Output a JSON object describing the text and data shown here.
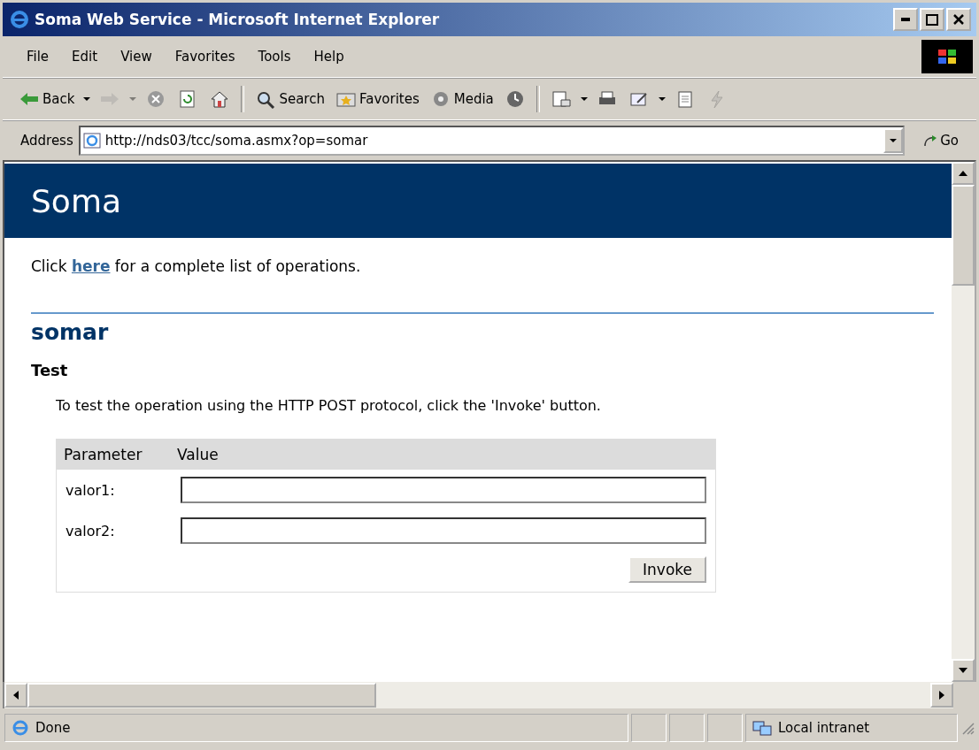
{
  "window": {
    "title": "Soma Web Service - Microsoft Internet Explorer"
  },
  "menu": [
    "File",
    "Edit",
    "View",
    "Favorites",
    "Tools",
    "Help"
  ],
  "toolbar": [
    {
      "kind": "back",
      "label": "Back",
      "disabled": false
    },
    {
      "kind": "forward",
      "disabled": true
    },
    {
      "kind": "stop",
      "disabled": false
    },
    {
      "kind": "refresh",
      "disabled": false
    },
    {
      "kind": "home",
      "disabled": false
    },
    {
      "kind": "search",
      "label": "Search",
      "disabled": false
    },
    {
      "kind": "favorites",
      "label": "Favorites",
      "disabled": false
    },
    {
      "kind": "media",
      "label": "Media",
      "disabled": false
    },
    {
      "kind": "history",
      "disabled": false
    },
    {
      "kind": "mail",
      "disabled": false
    },
    {
      "kind": "print",
      "disabled": false
    },
    {
      "kind": "edit",
      "disabled": false
    },
    {
      "kind": "discuss",
      "disabled": false
    },
    {
      "kind": "messenger",
      "disabled": true
    }
  ],
  "address": {
    "label": "Address",
    "value": "http://nds03/tcc/soma.asmx?op=somar",
    "go": "Go"
  },
  "page": {
    "banner": "Soma",
    "intro_before": "Click",
    "link": "here",
    "intro_after": "for a complete list of operations.",
    "operation": "somar",
    "section": "Test",
    "description": "To test the operation using the HTTP POST protocol, click the 'Invoke' button.",
    "table": {
      "columns": [
        "Parameter",
        "Value"
      ],
      "rows": [
        {
          "label": "valor1:"
        },
        {
          "label": "valor2:"
        }
      ]
    },
    "button": "Invoke"
  },
  "status_bar": {
    "text": "Done",
    "zone": "Local intranet"
  }
}
